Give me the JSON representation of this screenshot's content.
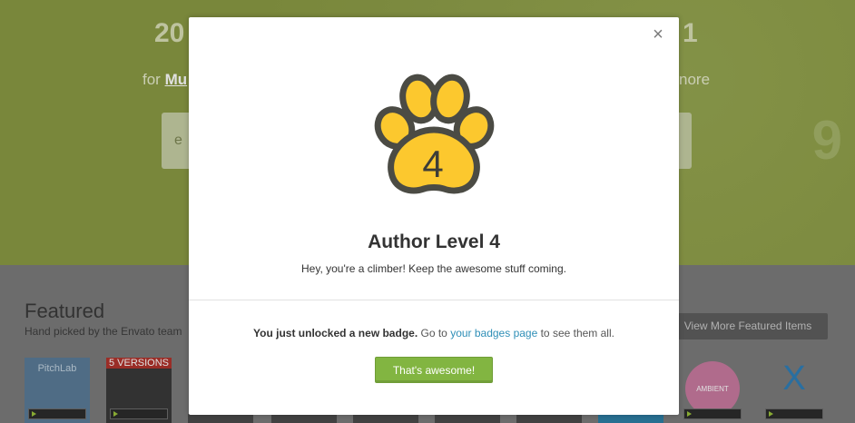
{
  "background": {
    "hero_left": "20",
    "hero_right": "1",
    "hero_sub_left_prefix": "for ",
    "hero_sub_left_link": "Mu",
    "hero_sub_right": "nore",
    "search_placeholder": "e",
    "hero_deco": "9",
    "featured_title": "Featured",
    "featured_subtitle": "Hand picked by the Envato team",
    "view_more_label": "View More Featured Items",
    "thumbs": [
      {
        "label": "PitchLab"
      },
      {
        "label": "5 VERSIONS"
      },
      {
        "label": ""
      },
      {
        "label": ""
      },
      {
        "label": ""
      },
      {
        "label": ""
      },
      {
        "label": ""
      },
      {
        "label": ""
      },
      {
        "label": "AMBIENT"
      },
      {
        "label": "X"
      }
    ]
  },
  "modal": {
    "close_label": "×",
    "badge_number": "4",
    "title": "Author Level 4",
    "description": "Hey, you're a climber! Keep the awesome stuff coming.",
    "unlock_strong": "You just unlocked a new badge.",
    "unlock_go": " Go to ",
    "unlock_link": "your badges page",
    "unlock_tail": " to see them all.",
    "confirm_label": "That's awesome!",
    "colors": {
      "paw_fill": "#fcc82e",
      "paw_outline": "#4b4b44",
      "button": "#82b541",
      "link": "#2f8fb7"
    }
  }
}
